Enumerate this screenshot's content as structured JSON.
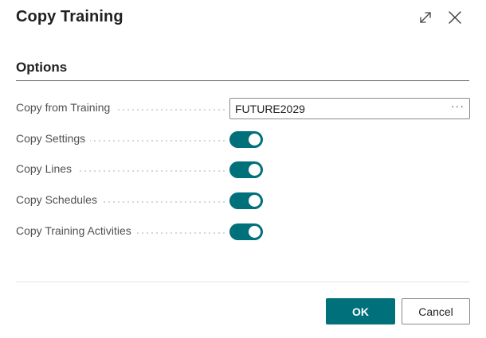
{
  "dialog": {
    "title": "Copy Training",
    "expand_icon": "expand-diagonal-arrows",
    "close_icon": "close-x"
  },
  "options": {
    "section_title": "Options",
    "fields": [
      {
        "label": "Copy from Training",
        "type": "lookup",
        "value": "FUTURE2029",
        "lookup_button": "···"
      },
      {
        "label": "Copy Settings",
        "type": "toggle",
        "on": true
      },
      {
        "label": "Copy Lines",
        "type": "toggle",
        "on": true
      },
      {
        "label": "Copy Schedules",
        "type": "toggle",
        "on": true
      },
      {
        "label": "Copy Training Activities",
        "type": "toggle",
        "on": true
      }
    ]
  },
  "footer": {
    "ok_label": "OK",
    "cancel_label": "Cancel"
  },
  "colors": {
    "accent": "#00707a",
    "text": "#212121",
    "label": "#505050"
  }
}
